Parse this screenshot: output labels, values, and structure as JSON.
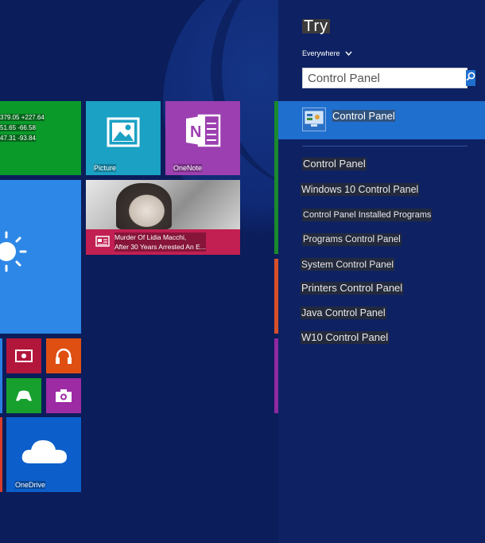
{
  "start": {
    "finance": {
      "lines": [
        "379.05 +227.64",
        "51.65 -66.58",
        "47.31 -93.84"
      ]
    },
    "pictures": {
      "label": "Picture"
    },
    "onenote": {
      "label": "OneNote"
    },
    "news": {
      "headline_line1": "Murder Of Lidia Macchi,",
      "headline_line2": "After 30 Years Arrested An E..."
    },
    "onedrive": {
      "label": "OneDrive"
    }
  },
  "charm": {
    "title": "Try",
    "scope": "Everywhere",
    "search": {
      "value": "Control Panel"
    },
    "top_result": {
      "label": "Control Panel"
    },
    "suggestions": [
      "Control Panel",
      "Windows 10 Control Panel",
      "Control Panel Installed Programs",
      "Programs Control Panel",
      "System Control Panel",
      "Printers Control Panel",
      "Java Control Panel",
      "W10 Control Panel"
    ]
  },
  "icons": [
    "pictures-icon",
    "onenote-icon",
    "sun-icon",
    "news-icon",
    "video-icon",
    "headphones-icon",
    "gamepad-icon",
    "camera-icon",
    "cloud-icon",
    "chevron-down-icon",
    "search-icon",
    "control-panel-icon"
  ],
  "colors": {
    "background": "#0c1f5c",
    "charm": "#0e2263",
    "accent": "#1f6fcf",
    "finance": "#0a9a2a",
    "pictures": "#1ba1c4",
    "onenote": "#9c3fb0",
    "weather": "#2d87e6",
    "news": "#c21f52"
  }
}
